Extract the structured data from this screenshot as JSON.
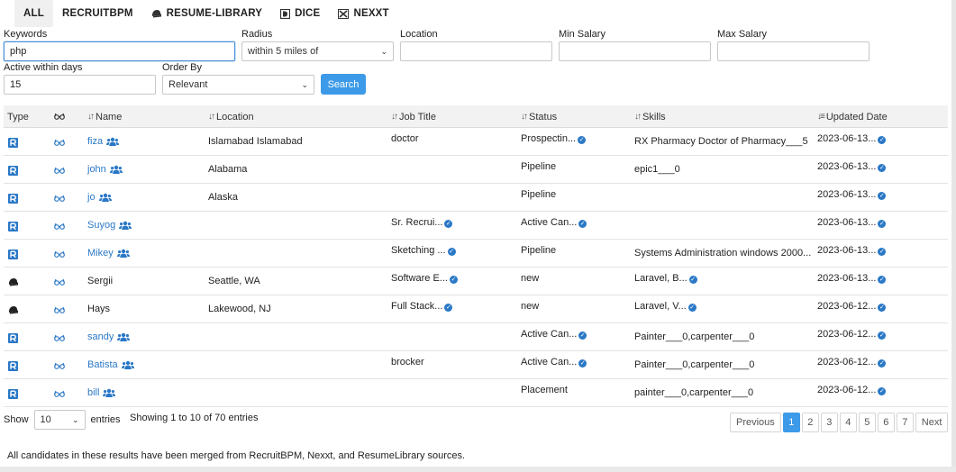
{
  "tabs": [
    {
      "label": "ALL",
      "icon": "none"
    },
    {
      "label": "RECRUITBPM",
      "icon": "none"
    },
    {
      "label": "RESUME-LIBRARY",
      "icon": "hat-icon"
    },
    {
      "label": "DICE",
      "icon": "dice-icon"
    },
    {
      "label": "NEXXT",
      "icon": "nexxt-icon"
    }
  ],
  "form": {
    "keywords_label": "Keywords",
    "keywords_value": "php",
    "radius_label": "Radius",
    "radius_value": "within 5 miles of",
    "location_label": "Location",
    "location_value": "",
    "min_salary_label": "Min Salary",
    "min_salary_value": "",
    "max_salary_label": "Max Salary",
    "max_salary_value": "",
    "active_label": "Active within days",
    "active_value": "15",
    "order_label": "Order By",
    "order_value": "Relevant",
    "search_label": "Search"
  },
  "table": {
    "headers": {
      "type": "Type",
      "name": "Name",
      "location": "Location",
      "job_title": "Job Title",
      "status": "Status",
      "skills": "Skills",
      "updated": "Updated Date"
    },
    "rows": [
      {
        "source": "recruitbpm",
        "name": "fiza",
        "name_link": true,
        "location": "Islamabad Islamabad",
        "job_title": "doctor",
        "job_more": false,
        "status": "Prospectin...",
        "status_more": true,
        "skills": "RX Pharmacy Doctor of Pharmacy___5",
        "skills_more": false,
        "updated": "2023-06-13..."
      },
      {
        "source": "recruitbpm",
        "name": "john",
        "name_link": true,
        "location": "Alabama",
        "job_title": "",
        "job_more": false,
        "status": "Pipeline",
        "status_more": false,
        "skills": "epic1___0",
        "skills_more": false,
        "updated": "2023-06-13..."
      },
      {
        "source": "recruitbpm",
        "name": "jo",
        "name_link": true,
        "location": "Alaska",
        "job_title": "",
        "job_more": false,
        "status": "Pipeline",
        "status_more": false,
        "skills": "",
        "skills_more": false,
        "updated": "2023-06-13..."
      },
      {
        "source": "recruitbpm",
        "name": "Suyog",
        "name_link": true,
        "location": "",
        "job_title": "Sr. Recrui...",
        "job_more": true,
        "status": "Active Can...",
        "status_more": true,
        "skills": "",
        "skills_more": false,
        "updated": "2023-06-13..."
      },
      {
        "source": "recruitbpm",
        "name": "Mikey",
        "name_link": true,
        "location": "",
        "job_title": "Sketching ...",
        "job_more": true,
        "status": "Pipeline",
        "status_more": false,
        "skills": "Systems Administration windows 2000...",
        "skills_more": false,
        "updated": "2023-06-13..."
      },
      {
        "source": "resume-library",
        "name": "Sergii",
        "name_link": false,
        "location": "Seattle, WA",
        "job_title": "Software E...",
        "job_more": true,
        "status": "new",
        "status_more": false,
        "skills": "Laravel, B...",
        "skills_more": true,
        "updated": "2023-06-13..."
      },
      {
        "source": "resume-library",
        "name": "Hays",
        "name_link": false,
        "location": "Lakewood, NJ",
        "job_title": "Full Stack...",
        "job_more": true,
        "status": "new",
        "status_more": false,
        "skills": "Laravel, V...",
        "skills_more": true,
        "updated": "2023-06-12..."
      },
      {
        "source": "recruitbpm",
        "name": "sandy",
        "name_link": true,
        "location": "",
        "job_title": "",
        "job_more": false,
        "status": "Active Can...",
        "status_more": true,
        "skills": "Painter___0,carpenter___0",
        "skills_more": false,
        "updated": "2023-06-12..."
      },
      {
        "source": "recruitbpm",
        "name": "Batista",
        "name_link": true,
        "location": "",
        "job_title": "brocker",
        "job_more": false,
        "status": "Active Can...",
        "status_more": true,
        "skills": "Painter___0,carpenter___0",
        "skills_more": false,
        "updated": "2023-06-12..."
      },
      {
        "source": "recruitbpm",
        "name": "bill",
        "name_link": true,
        "location": "",
        "job_title": "",
        "job_more": false,
        "status": "Placement",
        "status_more": false,
        "skills": "painter___0,carpenter___0",
        "skills_more": false,
        "updated": "2023-06-12..."
      }
    ]
  },
  "footer": {
    "show_label": "Show",
    "page_size": "10",
    "entries_label": "entries",
    "info": "Showing 1 to 10 of 70 entries",
    "previous": "Previous",
    "pages": [
      "1",
      "2",
      "3",
      "4",
      "5",
      "6",
      "7"
    ],
    "current_page": "1",
    "next": "Next",
    "note": "All candidates in these results have been merged from RecruitBPM, Nexxt, and ResumeLibrary sources."
  },
  "colors": {
    "accent": "#3d9ae8",
    "link": "#2a78c6",
    "header_bg": "#f2f2f2"
  }
}
